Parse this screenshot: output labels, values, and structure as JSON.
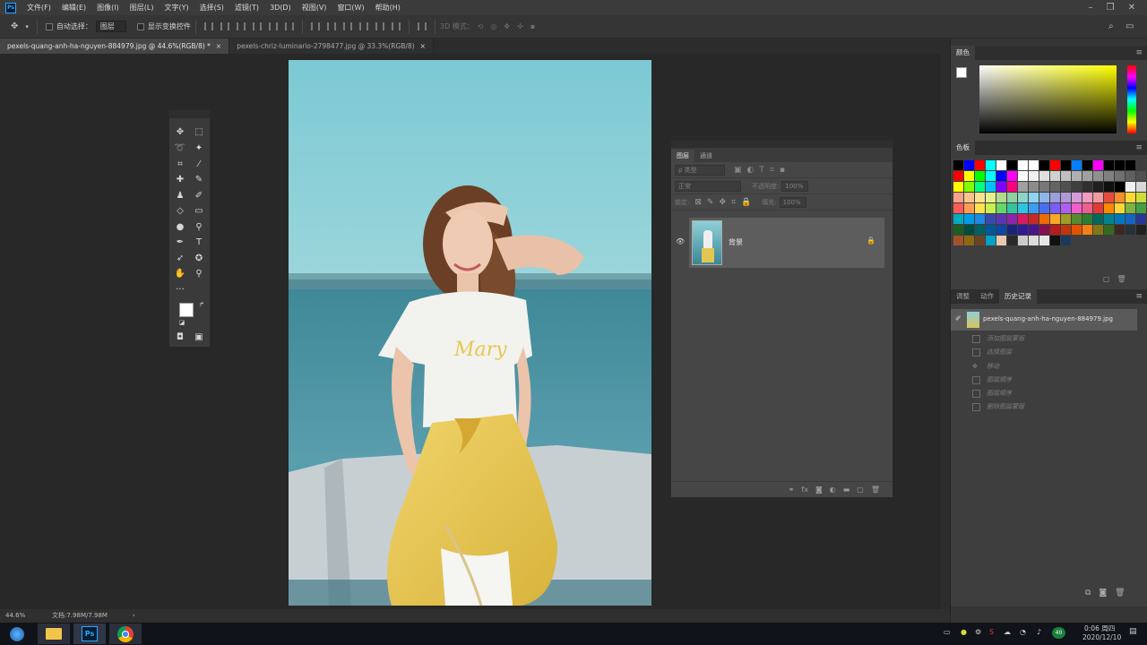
{
  "menubar": {
    "logo": "Ps",
    "items": [
      "文件(F)",
      "编辑(E)",
      "图像(I)",
      "图层(L)",
      "文字(Y)",
      "选择(S)",
      "滤镜(T)",
      "3D(D)",
      "视图(V)",
      "窗口(W)",
      "帮助(H)"
    ]
  },
  "options": {
    "auto_select_label": "自动选择：",
    "auto_select_value": "图层",
    "show_transform_label": "显示变换控件",
    "mode_3d_label": "3D 模式："
  },
  "tabs": [
    {
      "label": "pexels-quang-anh-ha-nguyen-884979.jpg @ 44.6%(RGB/8) *",
      "active": true
    },
    {
      "label": "pexels-chriz-luminario-2798477.jpg @ 33.3%(RGB/8)",
      "active": false
    }
  ],
  "status": {
    "zoom": "44.6%",
    "doc": "文档:7.98M/7.98M",
    "arrow": "›"
  },
  "layers_panel": {
    "tabs": [
      "图层",
      "通道"
    ],
    "kind_filter": "ρ 类型",
    "blend_mode": "正常",
    "opacity_label": "不透明度:",
    "opacity_value": "100%",
    "lock_label": "锁定:",
    "fill_label": "填充:",
    "fill_value": "100%",
    "layer_name": "背景"
  },
  "color_panel": {
    "title": "颜色"
  },
  "swatches_panel": {
    "title": "色板"
  },
  "history_panel": {
    "tabs": [
      "调整",
      "动作",
      "历史记录"
    ],
    "snapshot": "pexels-quang-anh-ha-nguyen-884979.jpg",
    "states": [
      "添加图层蒙版",
      "选择图层",
      "移动",
      "图层顺序",
      "图层顺序",
      "删除图层蒙版"
    ]
  },
  "taskbar": {
    "time": "0:06 周四",
    "date": "2020/12/10",
    "network_badge": "40"
  },
  "colors": {
    "accent": "#31a8ff",
    "cursor_highlight": "#d9a21b"
  },
  "swatch_rows": [
    [
      "#000000",
      "#0000ff",
      "#ff0000",
      "#00ffff",
      "#ffffff",
      "#000000",
      "#ffffff",
      "#ffffff",
      "#000000",
      "#ff0000",
      "#000000",
      "#0080ff",
      "#000000",
      "#ff00ff",
      "#000000",
      "#000000",
      "#000000"
    ],
    [
      "#ff0000",
      "#ffff00",
      "#00ff00",
      "#00ffff",
      "#0000ff",
      "#ff00ff",
      "#ffffff",
      "#f0f0f0",
      "#e0e0e0",
      "#d0d0d0",
      "#c0c0c0",
      "#b0b0b0",
      "#a0a0a0",
      "#909090",
      "#808080",
      "#707070",
      "#606060",
      "#505050",
      "#ff0000"
    ],
    [
      "#ffff00",
      "#80ff00",
      "#00ff80",
      "#00c0ff",
      "#8000ff",
      "#ff0080",
      "#a0a0a0",
      "#8c8c8c",
      "#787878",
      "#646464",
      "#505050",
      "#404040",
      "#303030",
      "#202020",
      "#101010",
      "#000000",
      "#f0f0f0",
      "#d8d8d8",
      "#c0c0c0"
    ],
    [
      "#f7a08a",
      "#f9c48c",
      "#fbe38e",
      "#e5ef8d",
      "#b3d98e",
      "#8ed0a0",
      "#8ed5c7",
      "#8ed6f0",
      "#8fb5e6",
      "#9b9ed9",
      "#b09ad6",
      "#d59bd5",
      "#f29bbf",
      "#f39aa0",
      "#e84c3d",
      "#f28e2b",
      "#fdd835",
      "#cddc39",
      "#8bc34a"
    ],
    [
      "#ff5a5a",
      "#ff9b52",
      "#ffe14d",
      "#c5f050",
      "#66d66b",
      "#34c3a0",
      "#2fc4e0",
      "#3b9cf0",
      "#4a6ef0",
      "#7b5ef0",
      "#b15ef0",
      "#f05ec9",
      "#f05e8e",
      "#e53935",
      "#fb8c00",
      "#fdd835",
      "#7cb342",
      "#43a047",
      "#00897b"
    ],
    [
      "#00acc1",
      "#039be5",
      "#1e88e5",
      "#3949ab",
      "#5e35b1",
      "#8e24aa",
      "#d81b60",
      "#c62828",
      "#ef6c00",
      "#f9a825",
      "#9e9d24",
      "#558b2f",
      "#2e7d32",
      "#00695c",
      "#00838f",
      "#0277bd",
      "#1565c0",
      "#283593",
      "#4527a0"
    ],
    [
      "#1b5e20",
      "#004d40",
      "#006064",
      "#01579b",
      "#0d47a1",
      "#1a237e",
      "#311b92",
      "#4a148c",
      "#880e4f",
      "#b71c1c",
      "#bf360c",
      "#e65100",
      "#f57f17",
      "#827717",
      "#33691e",
      "#3e2723",
      "#263238",
      "#212121",
      "#000000"
    ],
    [
      "#a0522d",
      "#8b6914",
      "#6b4423",
      "#00a0c8",
      "#e8c8b0",
      "#2a2a2a",
      "#cccccc",
      "#dddddd",
      "#e6e6e6",
      "#111111",
      "#1b3a5a"
    ]
  ]
}
